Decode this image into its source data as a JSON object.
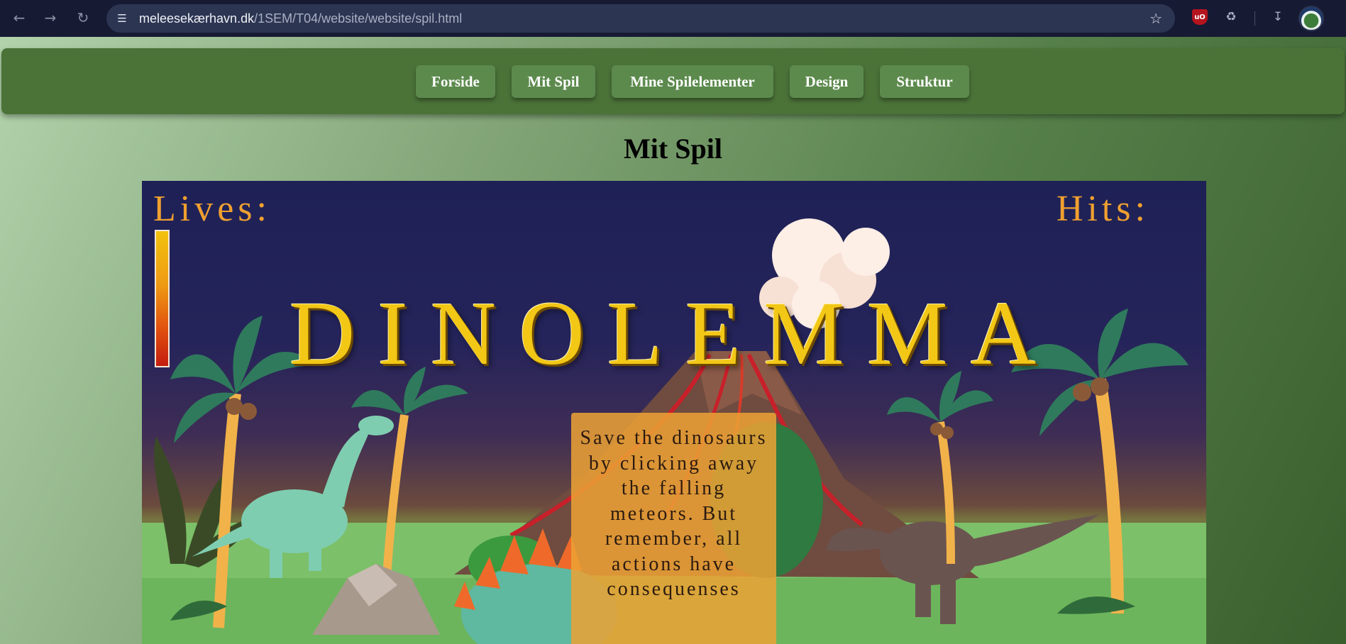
{
  "browser": {
    "url_host": "meleesekærhavn.dk",
    "url_path": "/1SEM/T04/website/website/spil.html",
    "icons": [
      "back-icon",
      "forward-icon",
      "reload-icon",
      "site-info-icon",
      "bookmark-star-icon",
      "ublock-icon",
      "extensions-icon",
      "download-icon",
      "profile-avatar"
    ]
  },
  "nav": {
    "items": [
      {
        "label": "Forside"
      },
      {
        "label": "Mit Spil"
      },
      {
        "label": "Mine Spilelementer"
      },
      {
        "label": "Design"
      },
      {
        "label": "Struktur"
      }
    ]
  },
  "page": {
    "title": "Mit Spil"
  },
  "game": {
    "lives_label": "Lives:",
    "hits_label": "Hits:",
    "lives_level": 1.0,
    "title": "DINOLEMMA",
    "instructions": "Save the dinosaurs by clicking away the falling meteors. But remember, all actions have consequenses"
  },
  "colors": {
    "page_bg_light": "#b3d4ad",
    "page_bg_dark": "#3a5f2e",
    "nav_bar": "#4b7338",
    "nav_button": "#5c8a4d",
    "hud_text": "#f0a030",
    "title_gold": "#f2c716",
    "info_box": "#eca234"
  }
}
